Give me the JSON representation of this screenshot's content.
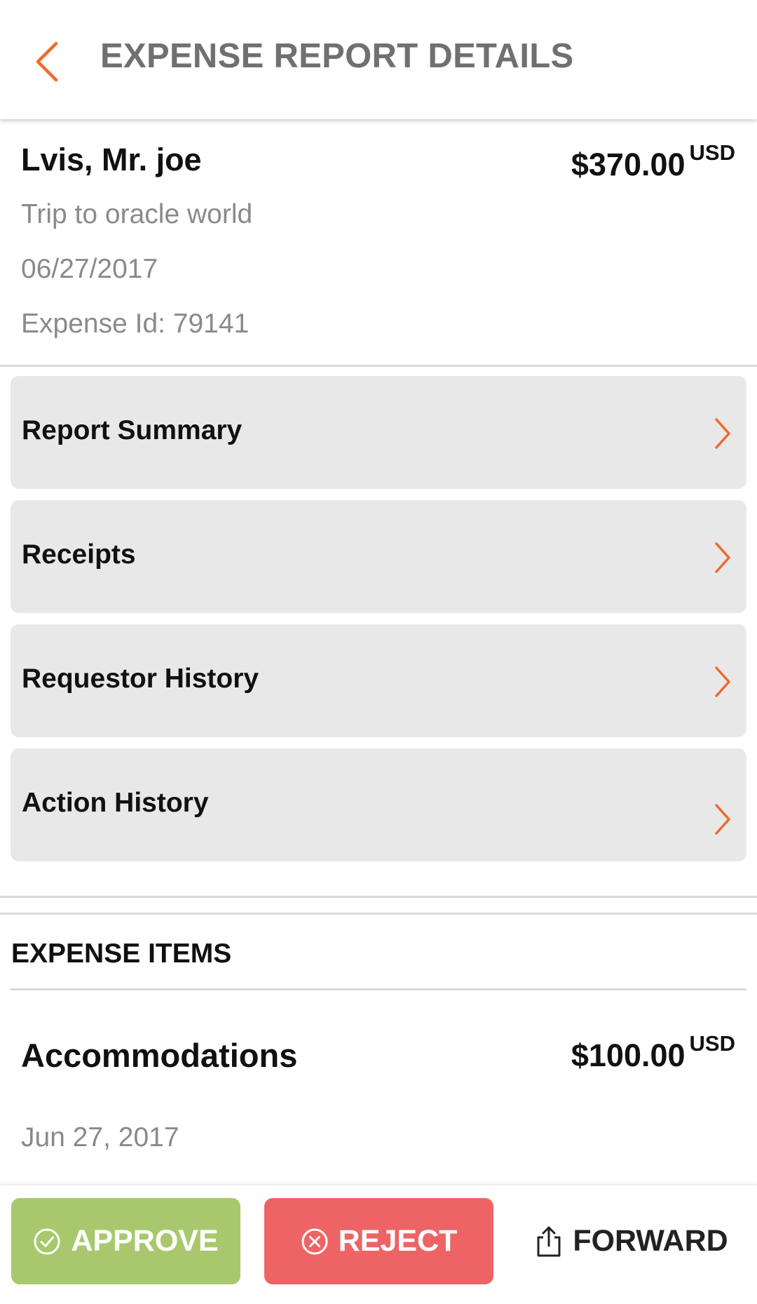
{
  "header": {
    "title": "EXPENSE REPORT DETAILS",
    "back_icon": "chevron-left-icon"
  },
  "report": {
    "requestor": "Lvis, Mr. joe",
    "amount": "$370.00",
    "currency": "USD",
    "purpose": "Trip to oracle world",
    "date": "06/27/2017",
    "expense_id": "Expense Id: 79141"
  },
  "nav": [
    {
      "label": "Report Summary",
      "icon": "chevron-right-icon"
    },
    {
      "label": "Receipts",
      "icon": "chevron-right-icon"
    },
    {
      "label": "Requestor History",
      "icon": "chevron-right-icon"
    },
    {
      "label": "Action History",
      "icon": "chevron-right-icon"
    }
  ],
  "expense_items": {
    "title": "EXPENSE ITEMS",
    "items": [
      {
        "name": "Accommodations",
        "amount": "$100.00",
        "currency": "USD",
        "date": "Jun 27, 2017"
      }
    ]
  },
  "actions": {
    "approve": "APPROVE",
    "reject": "REJECT",
    "forward": "FORWARD"
  },
  "colors": {
    "accent": "#f06a2a",
    "approve": "#a9c86d",
    "reject": "#ee6464",
    "card_bg": "#e8e8e8",
    "muted_text": "#8a8a8a",
    "header_text": "#707070"
  }
}
